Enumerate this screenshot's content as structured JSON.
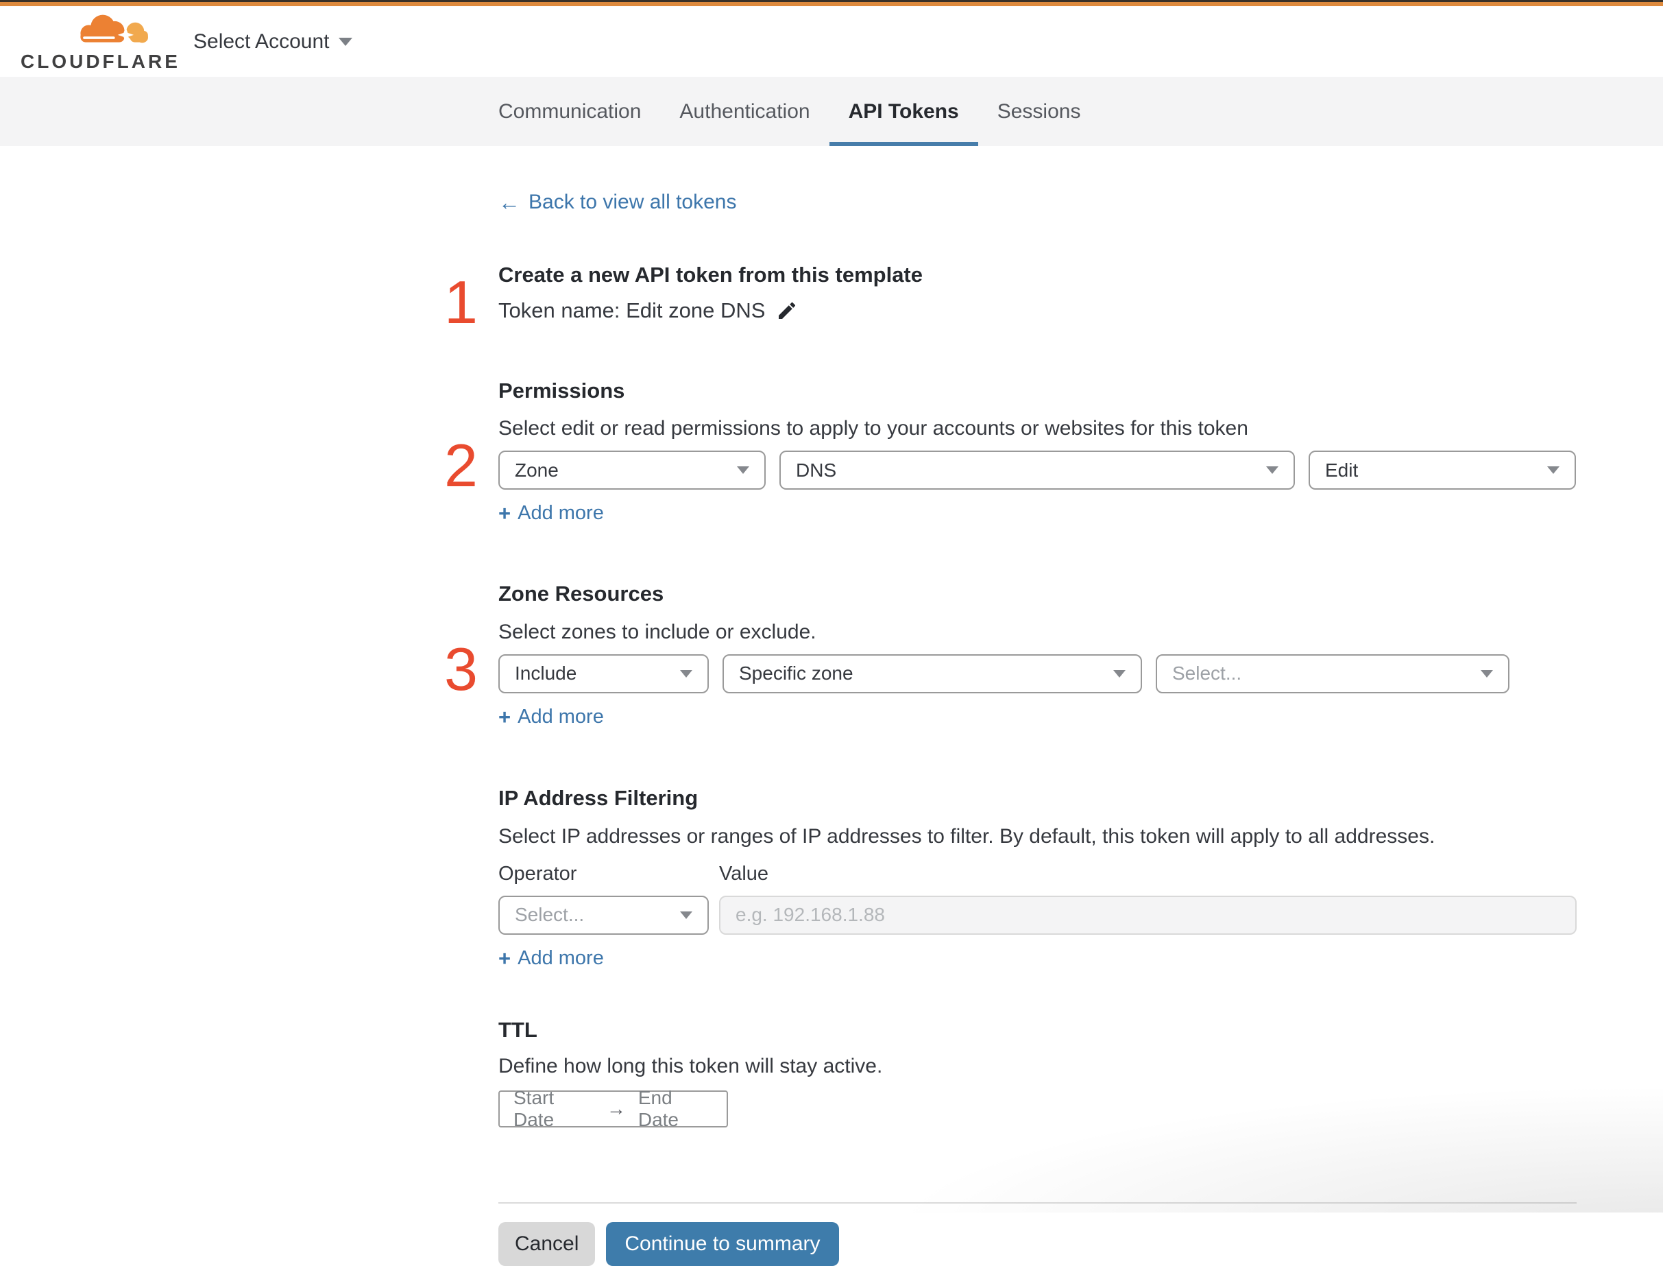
{
  "header": {
    "logo_text": "CLOUDFLARE",
    "account_selector": "Select Account"
  },
  "tabs": {
    "items": [
      {
        "label": "Communication",
        "active": false
      },
      {
        "label": "Authentication",
        "active": false
      },
      {
        "label": "API Tokens",
        "active": true
      },
      {
        "label": "Sessions",
        "active": false
      }
    ]
  },
  "back": {
    "arrow": "←",
    "label": "Back to view all tokens"
  },
  "steps": {
    "one": "1",
    "two": "2",
    "three": "3"
  },
  "token": {
    "heading": "Create a new API token from this template",
    "name_line": "Token name: Edit zone DNS"
  },
  "permissions": {
    "heading": "Permissions",
    "description": "Select edit or read permissions to apply to your accounts or websites for this token",
    "scope_value": "Zone",
    "resource_value": "DNS",
    "access_value": "Edit",
    "plus": "+",
    "add_more": "Add more"
  },
  "zone_resources": {
    "heading": "Zone Resources",
    "description": "Select zones to include or exclude.",
    "mode_value": "Include",
    "type_value": "Specific zone",
    "zone_placeholder": "Select...",
    "plus": "+",
    "add_more": "Add more"
  },
  "ip_filtering": {
    "heading": "IP Address Filtering",
    "description": "Select IP addresses or ranges of IP addresses to filter. By default, this token will apply to all addresses.",
    "operator_label": "Operator",
    "value_label": "Value",
    "operator_placeholder": "Select...",
    "value_placeholder": "e.g. 192.168.1.88",
    "plus": "+",
    "add_more": "Add more"
  },
  "ttl": {
    "heading": "TTL",
    "description": "Define how long this token will stay active.",
    "start_placeholder": "Start Date",
    "range_arrow": "→",
    "end_placeholder": "End Date"
  },
  "footer": {
    "cancel": "Cancel",
    "continue": "Continue to summary"
  },
  "colors": {
    "top_accent_orange": "#de8a3d",
    "link_blue": "#3d76ab",
    "active_tab_underline": "#477daa",
    "step_number_red": "#e94b2f",
    "primary_button_blue": "#3e7cab",
    "tabbar_background": "#f4f4f5"
  }
}
